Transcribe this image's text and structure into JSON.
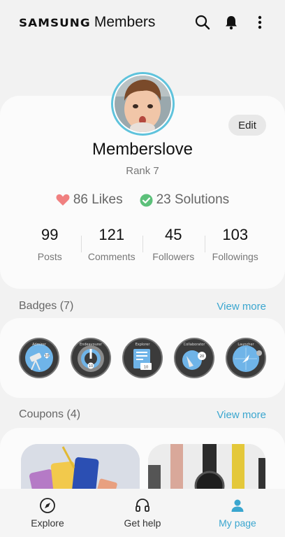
{
  "header": {
    "brand_primary": "SAMSUNG",
    "brand_secondary": "Members",
    "icons": [
      "search-icon",
      "bell-icon",
      "more-vertical-icon"
    ]
  },
  "profile": {
    "edit_label": "Edit",
    "username": "Memberslove",
    "rank": "Rank 7",
    "likes": "86 Likes",
    "solutions": "23 Solutions",
    "stats": [
      {
        "value": "99",
        "label": "Posts"
      },
      {
        "value": "121",
        "label": "Comments"
      },
      {
        "value": "45",
        "label": "Followers"
      },
      {
        "value": "103",
        "label": "Followings"
      }
    ]
  },
  "badges": {
    "title": "Badges (7)",
    "view_more": "View more",
    "items": [
      {
        "name": "Admirer",
        "level": "10"
      },
      {
        "name": "Endeavourer",
        "level": "10"
      },
      {
        "name": "Explorer",
        "level": "10"
      },
      {
        "name": "Collaborator",
        "level": "20"
      },
      {
        "name": "Launcher",
        "level": ""
      }
    ]
  },
  "coupons": {
    "title": "Coupons (4)",
    "view_more": "View more"
  },
  "nav": {
    "items": [
      {
        "label": "Explore",
        "icon": "compass-icon",
        "active": false
      },
      {
        "label": "Get help",
        "icon": "headset-icon",
        "active": false
      },
      {
        "label": "My page",
        "icon": "person-icon",
        "active": true
      }
    ]
  },
  "colors": {
    "accent": "#3aa6cf",
    "heart": "#f08080",
    "check": "#5cc07a",
    "avatar_ring": "#5fc3dc"
  }
}
